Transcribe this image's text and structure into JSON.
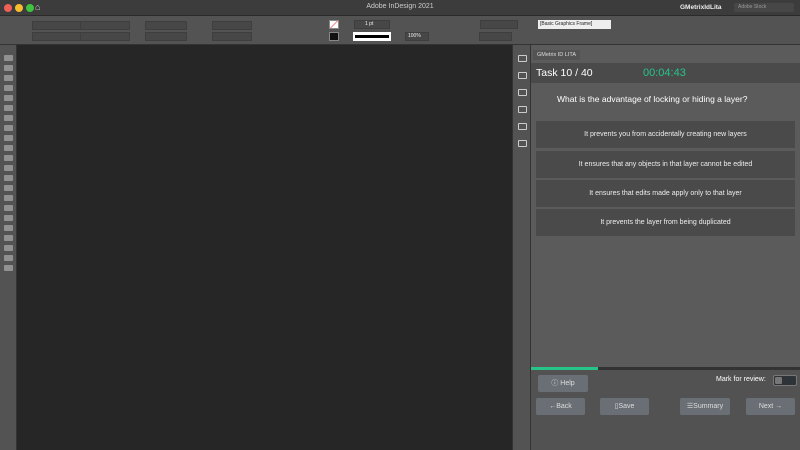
{
  "app": {
    "title": "Adobe InDesign 2021",
    "user": "GMetrixIdLita",
    "search_placeholder": "Adobe Stock"
  },
  "control_bar": {
    "stroke_weight": "1 pt",
    "scale": "100%",
    "object_style": "[Basic Graphics Frame]"
  },
  "panel": {
    "tab_label": "GMetrix ID LITA",
    "task_label": "Task 10 / 40",
    "timer": "00:04:43",
    "question": "What is the advantage of locking or hiding a layer?",
    "answers": [
      "It prevents you from accidentally creating new layers",
      "It ensures that any objects in that layer cannot be edited",
      "It ensures that edits made apply only to that layer",
      "It prevents the layer from being duplicated"
    ],
    "progress_percent": 25,
    "help_label": "Help",
    "mark_label": "Mark for review:",
    "mark_checked": false,
    "back_label": "Back",
    "save_label": "Save",
    "summary_label": "Summary",
    "next_label": "Next"
  },
  "colors": {
    "accent": "#27c48a"
  }
}
